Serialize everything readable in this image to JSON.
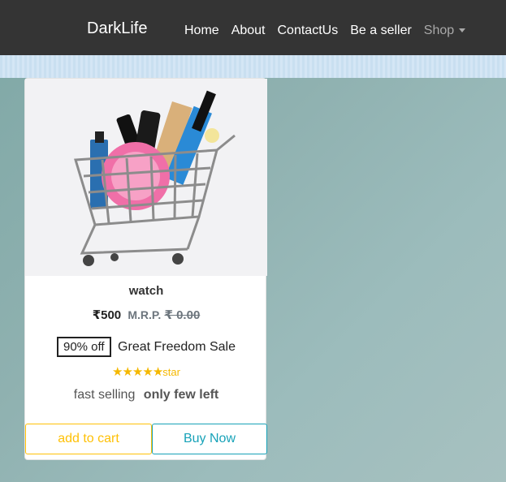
{
  "navbar": {
    "brand": "DarkLife",
    "links": [
      "Home",
      "About",
      "ContactUs",
      "Be a seller"
    ],
    "shop": "Shop"
  },
  "product": {
    "title": "watch",
    "price": "₹500",
    "mrp_label": "M.R.P.",
    "mrp_value": "₹ 0.00",
    "discount": "90% off",
    "sale": "Great Freedom Sale",
    "stars": "★★★★★",
    "rating_label": "star",
    "stock_text": "fast selling",
    "stock_emphasis": "only few left",
    "add_to_cart": "add to cart",
    "buy_now": "Buy Now"
  },
  "colors": {
    "cart": "#ffc107",
    "buy": "#17a2b8",
    "navbar": "#343434"
  }
}
